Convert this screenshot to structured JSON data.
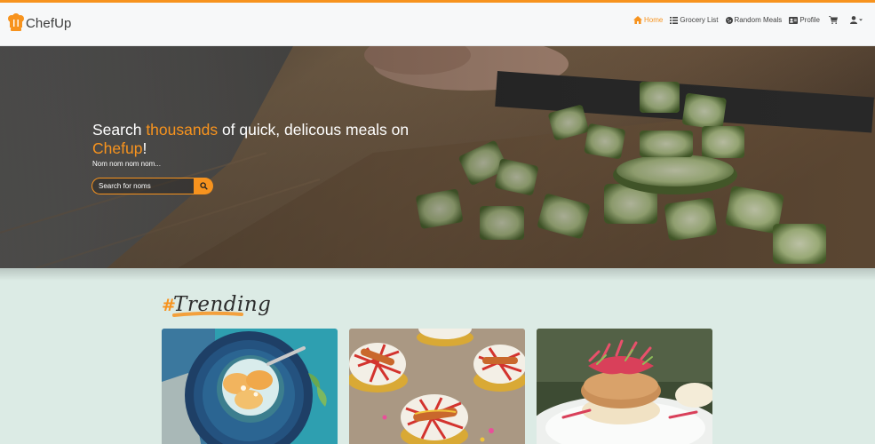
{
  "brand": {
    "name": "ChefUp"
  },
  "nav": {
    "items": [
      {
        "label": "Home",
        "icon": "home-icon",
        "active": true
      },
      {
        "label": "Grocery List",
        "icon": "list-icon",
        "active": false
      },
      {
        "label": "Random Meals",
        "icon": "cookie-icon",
        "active": false
      },
      {
        "label": "Profile",
        "icon": "id-card-icon",
        "active": false
      }
    ],
    "cart_icon": "cart-icon",
    "user_icon": "user-dropdown-icon"
  },
  "hero": {
    "title_part1": "Search ",
    "title_accent1": "thousands",
    "title_part2": " of quick, delicous meals on ",
    "title_accent2": "Chefup",
    "title_part3": "!",
    "subtitle": "Nom nom nom nom...",
    "search_placeholder": "Search for noms",
    "search_icon": "search-icon"
  },
  "trending": {
    "hash": "#",
    "label": "Trending"
  },
  "cards": [
    {
      "image": "peach-bowl-image"
    },
    {
      "image": "hotdog-cupcakes-image"
    },
    {
      "image": "burger-image"
    }
  ],
  "colors": {
    "accent": "#f7931e",
    "background": "#dcebe5",
    "navbar": "#f7f8f9"
  }
}
